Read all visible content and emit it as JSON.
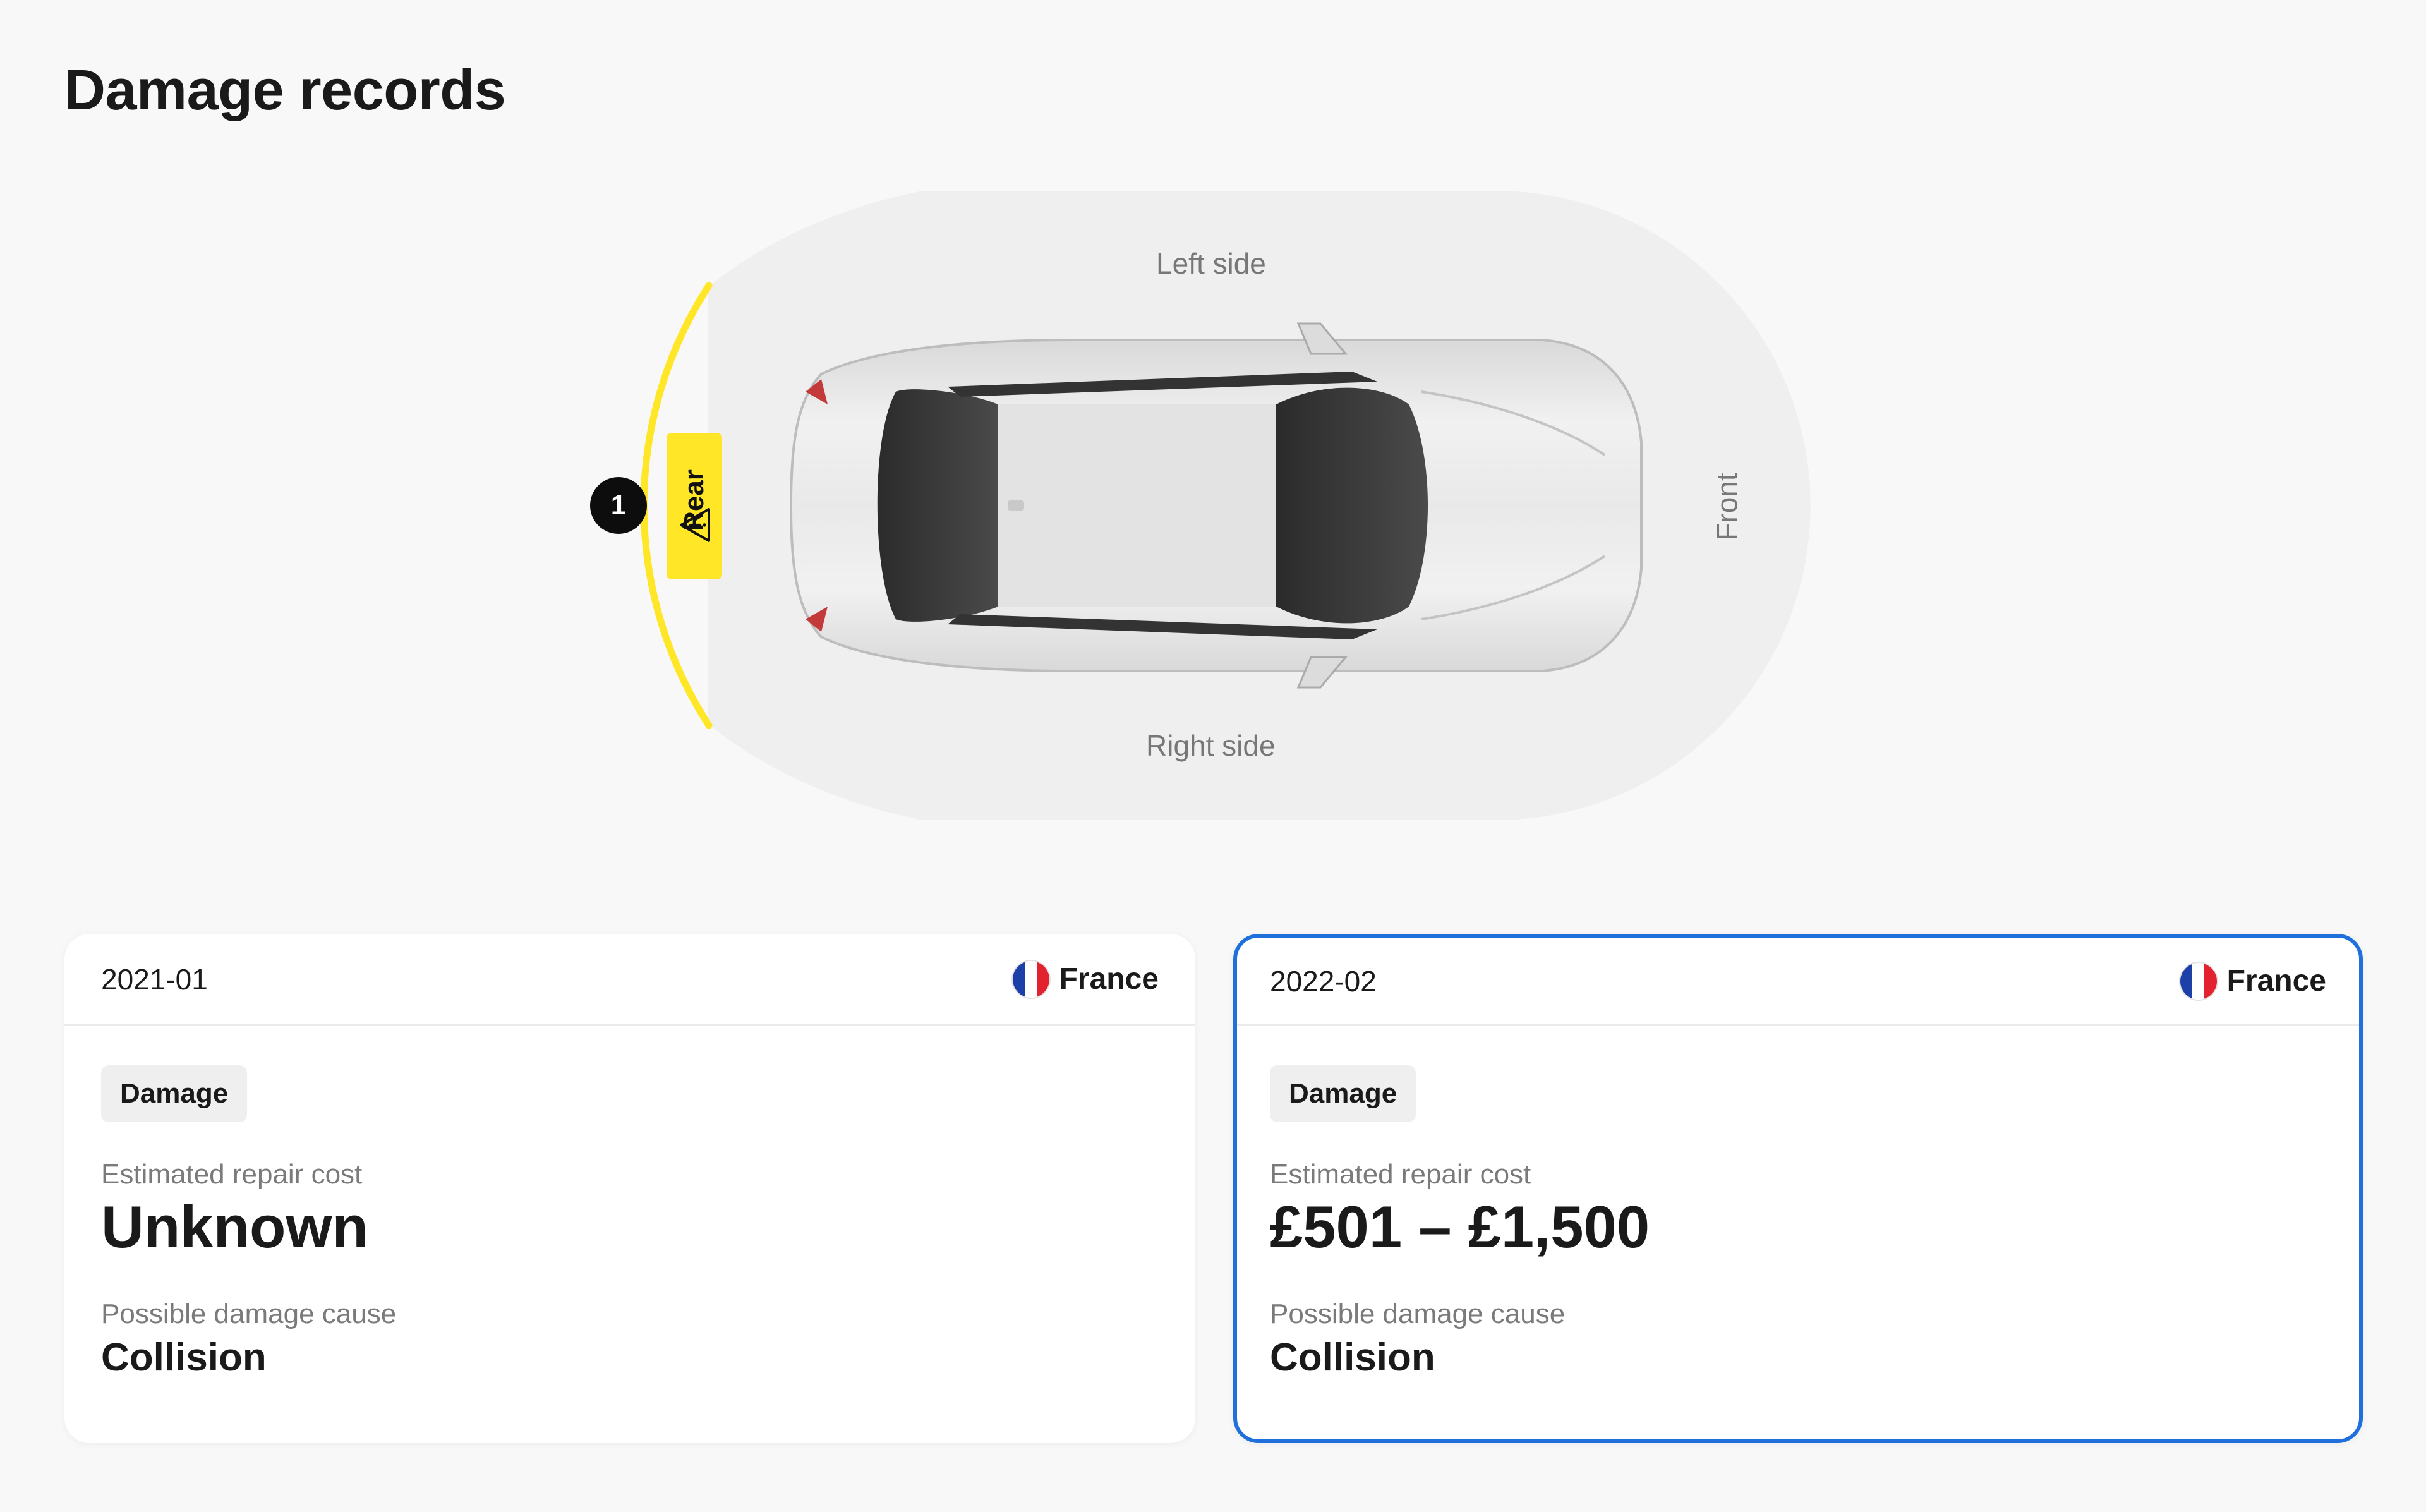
{
  "page": {
    "title": "Damage records"
  },
  "diagram": {
    "labels": {
      "left": "Left side",
      "right": "Right side",
      "front": "Front",
      "rear": "Rear"
    },
    "marker_number": "1",
    "highlight_color": "#ffe626",
    "zone_color": "#efefef",
    "icons": {
      "car": "car-top-view-icon",
      "warning": "warning-triangle-icon"
    }
  },
  "records": [
    {
      "date": "2021-01",
      "country": "France",
      "flag": "france-flag-icon",
      "badge": "Damage",
      "cost_label": "Estimated repair cost",
      "cost_value": "Unknown",
      "cause_label": "Possible damage cause",
      "cause_value": "Collision",
      "selected": false
    },
    {
      "date": "2022-02",
      "country": "France",
      "flag": "france-flag-icon",
      "badge": "Damage",
      "cost_label": "Estimated repair cost",
      "cost_value": "£501 – £1,500",
      "cause_label": "Possible damage cause",
      "cause_value": "Collision",
      "selected": true,
      "selected_border_color": "#1f6fdc"
    }
  ]
}
